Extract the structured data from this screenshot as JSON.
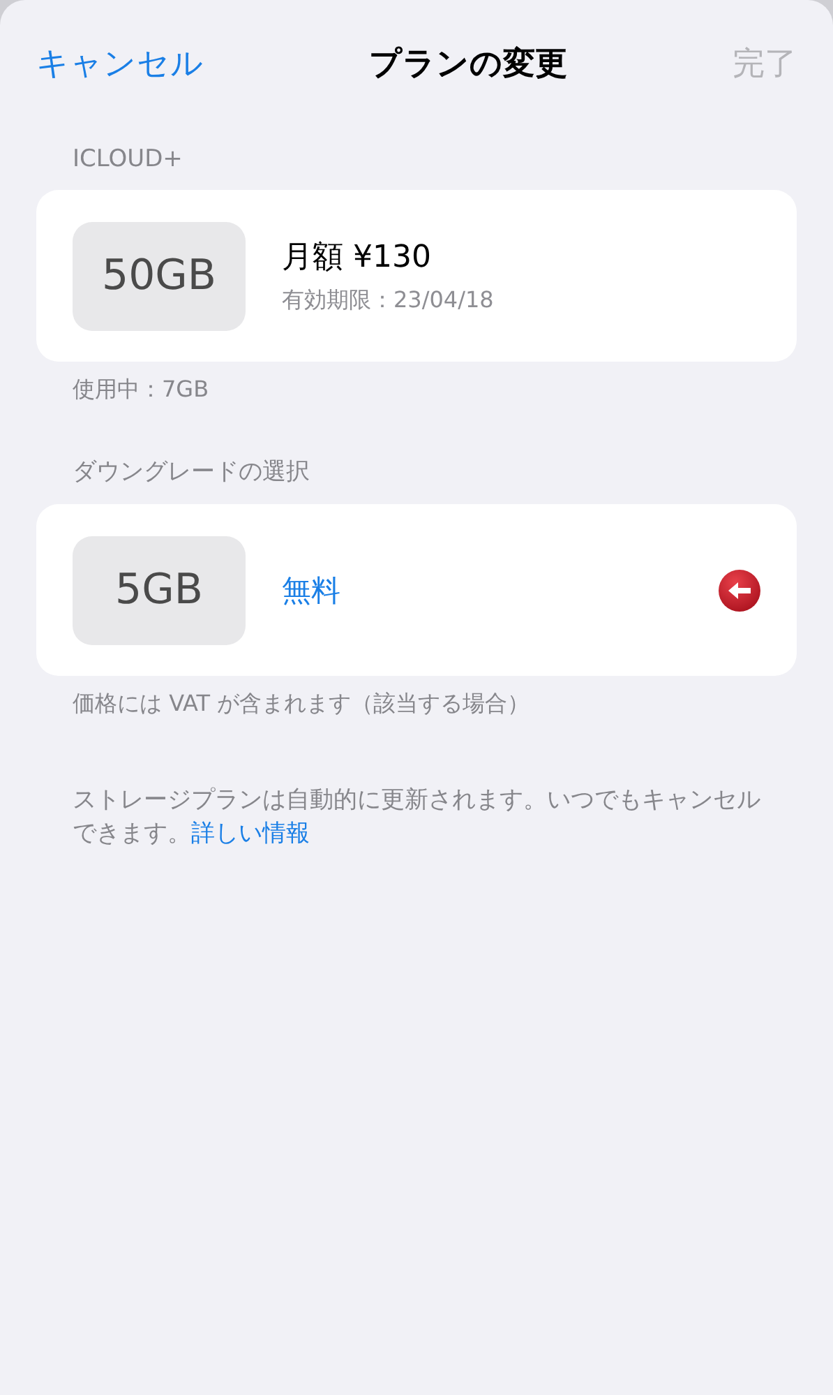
{
  "nav": {
    "cancel": "キャンセル",
    "title": "プランの変更",
    "done": {
      "label": "完了",
      "disabled": true
    }
  },
  "current": {
    "header": "ICLOUD+",
    "size": "50GB",
    "price": "月額 ¥130",
    "expiry": "有効期限：23/04/18",
    "usage": "使用中：7GB"
  },
  "downgrade": {
    "header": "ダウングレードの選択",
    "options": [
      {
        "size": "5GB",
        "price": "無料",
        "selected": true
      }
    ],
    "footer": "価格には VAT が含まれます（該当する場合）"
  },
  "note": {
    "text": "ストレージプランは自動的に更新されます。いつでもキャンセルできます。",
    "link": "詳しい情報"
  }
}
